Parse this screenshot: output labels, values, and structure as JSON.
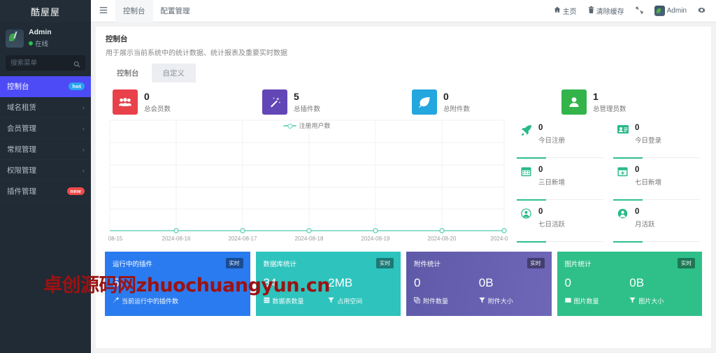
{
  "sidebar": {
    "brand": "酷屋屋",
    "user": {
      "name": "Admin",
      "status": "在线",
      "avatar_icon": "user-avatar"
    },
    "search": {
      "placeholder": "搜索菜单",
      "icon": "search-icon"
    },
    "items": [
      {
        "label": "控制台",
        "badge": "hot",
        "badge_type": "hot",
        "active": true
      },
      {
        "label": "域名租赁",
        "chevron": "‹",
        "active": false
      },
      {
        "label": "会员管理",
        "chevron": "‹",
        "active": false
      },
      {
        "label": "常规管理",
        "chevron": "‹",
        "active": false
      },
      {
        "label": "权限管理",
        "chevron": "‹",
        "active": false
      },
      {
        "label": "插件管理",
        "badge": "new",
        "badge_type": "new",
        "active": false
      }
    ]
  },
  "topbar": {
    "menu_icon": "hamburger-icon",
    "tabs": [
      {
        "label": "控制台",
        "current": true
      },
      {
        "label": "配置管理",
        "current": false
      }
    ],
    "actions": [
      {
        "label": "主页",
        "icon": "home-icon"
      },
      {
        "label": "清除缓存",
        "icon": "trash-icon"
      },
      {
        "label": "",
        "icon": "fullscreen-icon"
      },
      {
        "label": "Admin",
        "icon": "avatar-icon"
      },
      {
        "label": "",
        "icon": "gear-icon"
      }
    ]
  },
  "panel": {
    "title": "控制台",
    "subtitle": "用于展示当前系统中的统计数据、统计报表及重要实时数据",
    "tabs": [
      {
        "label": "控制台",
        "active": true
      },
      {
        "label": "自定义",
        "active": false
      }
    ]
  },
  "stats": [
    {
      "value": "0",
      "label": "总会员数",
      "color": "#e8414a",
      "icon": "users-icon"
    },
    {
      "value": "5",
      "label": "总插件数",
      "color": "#6246b5",
      "icon": "magic-wand-icon"
    },
    {
      "value": "0",
      "label": "总附件数",
      "color": "#24a6de",
      "icon": "leaf-icon"
    },
    {
      "value": "1",
      "label": "总管理员数",
      "color": "#32b44a",
      "icon": "user-icon"
    }
  ],
  "mini_stats": [
    {
      "value": "0",
      "label": "今日注册",
      "icon": "rocket-icon"
    },
    {
      "value": "0",
      "label": "今日登录",
      "icon": "id-card-icon"
    },
    {
      "value": "0",
      "label": "三日新增",
      "icon": "calendar-icon"
    },
    {
      "value": "0",
      "label": "七日新增",
      "icon": "calendar-plus-icon"
    },
    {
      "value": "0",
      "label": "七日活跃",
      "icon": "user-circle-icon"
    },
    {
      "value": "0",
      "label": "月活跃",
      "icon": "user-circle-filled-icon"
    }
  ],
  "cards": [
    {
      "title": "运行中的插件",
      "tag": "实时",
      "theme": "blue",
      "values": [
        "5"
      ],
      "foots": [
        {
          "label": "当前运行中的插件数",
          "icon": "plug-icon"
        }
      ]
    },
    {
      "title": "数据库统计",
      "tag": "实时",
      "theme": "teal",
      "values": [
        "34",
        "2MB"
      ],
      "foots": [
        {
          "label": "数据表数量",
          "icon": "database-icon"
        },
        {
          "label": "占用空间",
          "icon": "filter-icon"
        }
      ]
    },
    {
      "title": "附件统计",
      "tag": "实时",
      "theme": "purple",
      "values": [
        "0",
        "0B"
      ],
      "foots": [
        {
          "label": "附件数量",
          "icon": "clone-icon"
        },
        {
          "label": "附件大小",
          "icon": "filter-icon"
        }
      ]
    },
    {
      "title": "图片统计",
      "tag": "实时",
      "theme": "green",
      "values": [
        "0",
        "0B"
      ],
      "foots": [
        {
          "label": "图片数量",
          "icon": "image-icon"
        },
        {
          "label": "图片大小",
          "icon": "filter-icon"
        }
      ]
    }
  ],
  "watermark": {
    "text": "卓创源码网zhuochuangyun.cn",
    "color": "#9c1212"
  },
  "chart_data": {
    "type": "line",
    "title": "",
    "legend": [
      "注册用户数"
    ],
    "legend_position": "top-center",
    "xlabel": "",
    "ylabel": "",
    "grid": true,
    "line_color": "#6fd6bd",
    "categories": [
      "08-15",
      "2024-08-16",
      "2024-08-17",
      "2024-08-18",
      "2024-08-19",
      "2024-08-20",
      "2024-0"
    ],
    "series": [
      {
        "name": "注册用户数",
        "values": [
          0,
          0,
          0,
          0,
          0,
          0,
          0
        ]
      }
    ],
    "ylim": [
      0,
      5
    ],
    "yticks": []
  }
}
